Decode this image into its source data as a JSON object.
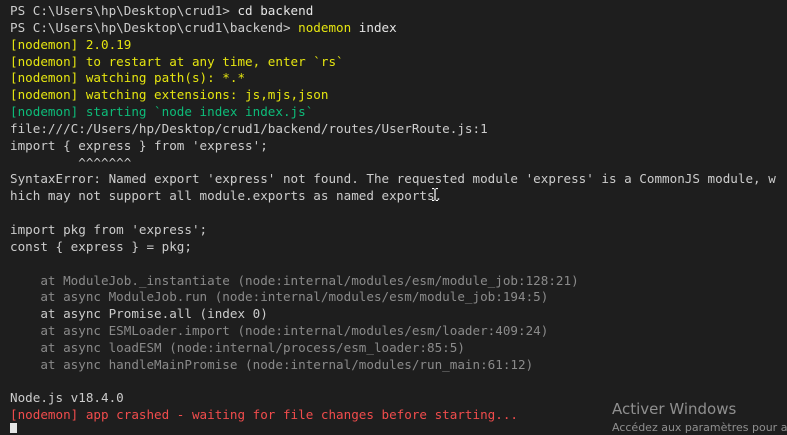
{
  "terminal": {
    "lines": [
      [
        {
          "text": "PS C:\\Users\\hp\\Desktop\\crud1> ",
          "color": "default"
        },
        {
          "text": "cd backend",
          "color": "white"
        }
      ],
      [
        {
          "text": "PS C:\\Users\\hp\\Desktop\\crud1\\backend> ",
          "color": "default"
        },
        {
          "text": "nodemon",
          "color": "yellow"
        },
        {
          "text": " index",
          "color": "white"
        }
      ],
      [
        {
          "text": "[nodemon] 2.0.19",
          "color": "yellow"
        }
      ],
      [
        {
          "text": "[nodemon] to restart at any time, enter `rs`",
          "color": "yellow"
        }
      ],
      [
        {
          "text": "[nodemon] watching path(s): *.*",
          "color": "yellow"
        }
      ],
      [
        {
          "text": "[nodemon] watching extensions: js,mjs,json",
          "color": "yellow"
        }
      ],
      [
        {
          "text": "[nodemon] starting `node index index.js`",
          "color": "green"
        }
      ],
      [
        {
          "text": "file:///C:/Users/hp/Desktop/crud1/backend/routes/UserRoute.js:1",
          "color": "default"
        }
      ],
      [
        {
          "text": "import { express } from 'express';",
          "color": "default"
        }
      ],
      [
        {
          "text": "         ^^^^^^^",
          "color": "default"
        }
      ],
      [
        {
          "text": "SyntaxError: Named export 'express' not found. The requested module 'express' is a CommonJS module, w",
          "color": "default"
        }
      ],
      [
        {
          "text": "hich may not support all module.exports as named exports.",
          "color": "default",
          "cursor_after": 56
        }
      ],
      [
        {
          "text": "",
          "color": "default"
        }
      ],
      [
        {
          "text": "import pkg from 'express';",
          "color": "default"
        }
      ],
      [
        {
          "text": "const { express } = pkg;",
          "color": "default"
        }
      ],
      [
        {
          "text": "",
          "color": "default"
        }
      ],
      [
        {
          "text": "    at ModuleJob._instantiate (node:internal/modules/esm/module_job:128:21)",
          "color": "gray"
        }
      ],
      [
        {
          "text": "    at async ModuleJob.run (node:internal/modules/esm/module_job:194:5)",
          "color": "gray"
        }
      ],
      [
        {
          "text": "    at async Promise.all (index 0)",
          "color": "default"
        }
      ],
      [
        {
          "text": "    at async ESMLoader.import (node:internal/modules/esm/loader:409:24)",
          "color": "gray"
        }
      ],
      [
        {
          "text": "    at async loadESM (node:internal/process/esm_loader:85:5)",
          "color": "gray"
        }
      ],
      [
        {
          "text": "    at async handleMainPromise (node:internal/modules/run_main:61:12)",
          "color": "gray"
        }
      ],
      [
        {
          "text": "",
          "color": "default"
        }
      ],
      [
        {
          "text": "Node.js v18.4.0",
          "color": "default"
        }
      ],
      [
        {
          "text": "[nodemon] app crashed - waiting for file changes before starting...",
          "color": "red"
        }
      ]
    ]
  },
  "watermark": {
    "title": "Activer Windows",
    "subtitle": "Accédez aux paramètres pour a"
  },
  "colors": {
    "background": "#1e1e1e",
    "default": "#cccccc",
    "white": "#e5e5e5",
    "yellow": "#e5e510",
    "green": "#0dbc79",
    "gray": "#8a8a8a",
    "red": "#f14c4c"
  }
}
